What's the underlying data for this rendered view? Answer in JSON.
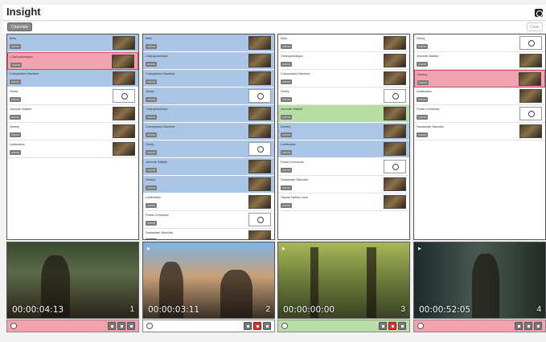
{
  "app": {
    "title": "Insight"
  },
  "toolbar": {
    "channels_label": "Channels",
    "clear_label": "Clear"
  },
  "columns": [
    {
      "items": [
        {
          "name": "Bets",
          "badge": "0:00:15",
          "state": "blue",
          "thumb": "video"
        },
        {
          "name": "Championships",
          "badge": "0:00:30",
          "state": "red",
          "thumb": "video"
        },
        {
          "name": "Companies Machine",
          "badge": "0:00:20",
          "state": "blue",
          "thumb": "video"
        },
        {
          "name": "Geely",
          "badge": "0:00:10",
          "state": "white",
          "thumb": "logo"
        },
        {
          "name": "Johnnie Walker",
          "badge": "0:00:15",
          "state": "white",
          "thumb": "video"
        },
        {
          "name": "Dewey",
          "badge": "0:00:15",
          "state": "white",
          "thumb": "video"
        },
        {
          "name": "Ladbrokes",
          "badge": "0:00:20",
          "state": "white",
          "thumb": "video"
        }
      ]
    },
    {
      "items": [
        {
          "name": "Bets",
          "badge": "0:00:15",
          "state": "blue",
          "thumb": "video"
        },
        {
          "name": "Championships",
          "badge": "0:00:30",
          "state": "blue",
          "thumb": "video"
        },
        {
          "name": "Companies Machine",
          "badge": "0:00:20",
          "state": "blue",
          "thumb": "video"
        },
        {
          "name": "Geely",
          "badge": "0:00:10",
          "state": "blue",
          "thumb": "logo"
        },
        {
          "name": "Championships",
          "badge": "0:00:30",
          "state": "blue",
          "thumb": "video"
        },
        {
          "name": "Companies Machine",
          "badge": "0:00:20",
          "state": "blue",
          "thumb": "video"
        },
        {
          "name": "Geely",
          "badge": "0:00:10",
          "state": "blue",
          "thumb": "logo"
        },
        {
          "name": "Johnnie Walker",
          "badge": "0:00:15",
          "state": "blue",
          "thumb": "video"
        },
        {
          "name": "Dewey",
          "badge": "0:00:15",
          "state": "blue",
          "thumb": "video"
        },
        {
          "name": "Ladbrokes",
          "badge": "0:00:20",
          "state": "white",
          "thumb": "video"
        },
        {
          "name": "Punta Cervezas",
          "badge": "0:00:15",
          "state": "white",
          "thumb": "logo"
        },
        {
          "name": "Santander Mundial",
          "badge": "0:00:20",
          "state": "white",
          "thumb": "video"
        }
      ]
    },
    {
      "items": [
        {
          "name": "Bets",
          "badge": "0:00:15",
          "state": "white",
          "thumb": "video"
        },
        {
          "name": "Championships",
          "badge": "0:00:30",
          "state": "white",
          "thumb": "video"
        },
        {
          "name": "Companies Machine",
          "badge": "0:00:20",
          "state": "white",
          "thumb": "video"
        },
        {
          "name": "Geely",
          "badge": "0:00:10",
          "state": "white",
          "thumb": "logo"
        },
        {
          "name": "Johnnie Walker",
          "badge": "0:00:15",
          "state": "green",
          "thumb": "video"
        },
        {
          "name": "Dewey",
          "badge": "0:00:15",
          "state": "blue",
          "thumb": "video"
        },
        {
          "name": "Ladbrokes",
          "badge": "0:00:20",
          "state": "blue",
          "thumb": "video"
        },
        {
          "name": "Punta Cervezas",
          "badge": "0:00:15",
          "state": "white",
          "thumb": "logo"
        },
        {
          "name": "Santander Mundial",
          "badge": "0:00:20",
          "state": "white",
          "thumb": "video"
        },
        {
          "name": "Toyota Hybrid Love",
          "badge": "0:00:30",
          "state": "white",
          "thumb": "video"
        }
      ]
    },
    {
      "items": [
        {
          "name": "Geely",
          "badge": "0:00:10",
          "state": "white",
          "thumb": "logo"
        },
        {
          "name": "Johnnie Walker",
          "badge": "0:00:15",
          "state": "white",
          "thumb": "video"
        },
        {
          "name": "Dewey",
          "badge": "0:00:15",
          "state": "red",
          "thumb": "video"
        },
        {
          "name": "Ladbrokes",
          "badge": "0:00:20",
          "state": "white",
          "thumb": "video"
        },
        {
          "name": "Punta Cervezas",
          "badge": "0:00:15",
          "state": "white",
          "thumb": "logo"
        },
        {
          "name": "Santander Mundial",
          "badge": "0:00:20",
          "state": "white",
          "thumb": "video"
        }
      ]
    }
  ],
  "players": [
    {
      "timecode": "00:00:04:13",
      "number": "1",
      "control_state": "red",
      "active_button": ""
    },
    {
      "timecode": "00:00:03:11",
      "number": "2",
      "control_state": "white",
      "active_button": "stop"
    },
    {
      "timecode": "00:00:00:00",
      "number": "3",
      "control_state": "green",
      "active_button": "stop"
    },
    {
      "timecode": "00:00:52:05",
      "number": "4",
      "control_state": "red",
      "active_button": ""
    }
  ]
}
